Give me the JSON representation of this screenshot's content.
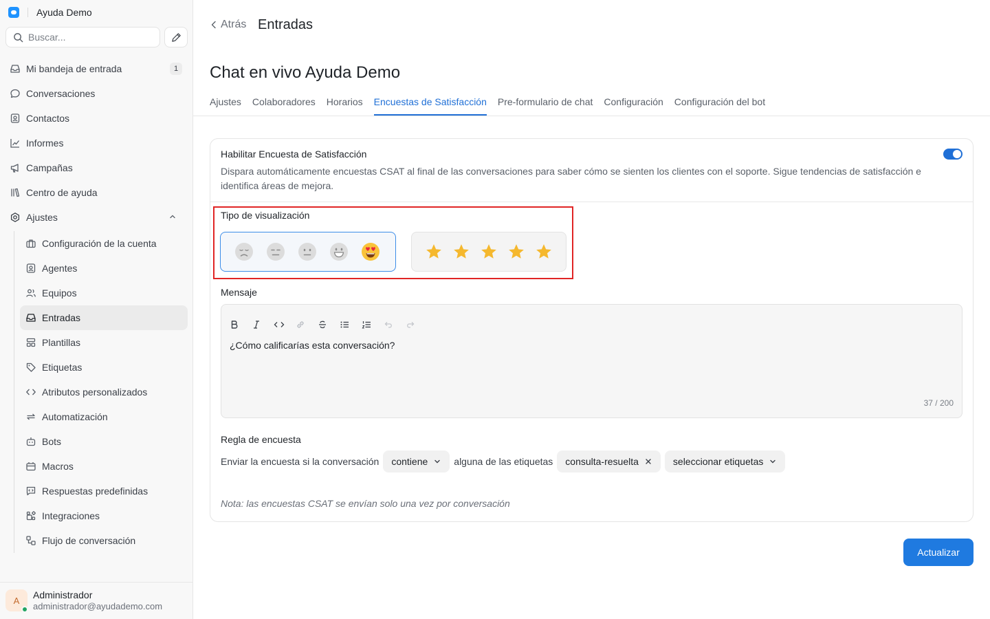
{
  "brand": {
    "name": "Ayuda Demo",
    "accent": "#1f93ff"
  },
  "search": {
    "placeholder": "Buscar..."
  },
  "sidebar": {
    "items": [
      {
        "label": "Mi bandeja de entrada",
        "icon": "inbox-icon",
        "badge": "1"
      },
      {
        "label": "Conversaciones",
        "icon": "chat-bubble-icon"
      },
      {
        "label": "Contactos",
        "icon": "contact-card-icon"
      },
      {
        "label": "Informes",
        "icon": "chart-line-icon"
      },
      {
        "label": "Campañas",
        "icon": "megaphone-icon"
      },
      {
        "label": "Centro de ayuda",
        "icon": "library-icon"
      },
      {
        "label": "Ajustes",
        "icon": "settings-gear-icon",
        "expanded": true
      }
    ],
    "settings_items": [
      {
        "label": "Configuración de la cuenta",
        "icon": "briefcase-icon"
      },
      {
        "label": "Agentes",
        "icon": "agent-card-icon"
      },
      {
        "label": "Equipos",
        "icon": "users-icon"
      },
      {
        "label": "Entradas",
        "icon": "inbox-icon",
        "active": true
      },
      {
        "label": "Plantillas",
        "icon": "template-icon"
      },
      {
        "label": "Etiquetas",
        "icon": "tag-icon"
      },
      {
        "label": "Atributos personalizados",
        "icon": "code-icon"
      },
      {
        "label": "Automatización",
        "icon": "arrows-repeat-icon"
      },
      {
        "label": "Bots",
        "icon": "bot-icon"
      },
      {
        "label": "Macros",
        "icon": "macro-box-icon"
      },
      {
        "label": "Respuestas predefinidas",
        "icon": "canned-reply-icon"
      },
      {
        "label": "Integraciones",
        "icon": "puzzle-icon"
      },
      {
        "label": "Flujo de conversación",
        "icon": "flow-icon"
      }
    ]
  },
  "user": {
    "initial": "A",
    "name": "Administrador",
    "email": "administrador@ayudademo.com",
    "status": "online"
  },
  "header": {
    "back_label": "Atrás",
    "title": "Entradas"
  },
  "inbox": {
    "name": "Chat en vivo Ayuda Demo"
  },
  "tabs": [
    {
      "label": "Ajustes"
    },
    {
      "label": "Colaboradores"
    },
    {
      "label": "Horarios"
    },
    {
      "label": "Encuestas de Satisfacción",
      "active": true
    },
    {
      "label": "Pre-formulario de chat"
    },
    {
      "label": "Configuración"
    },
    {
      "label": "Configuración del bot"
    }
  ],
  "csat": {
    "enable_title": "Habilitar Encuesta de Satisfacción",
    "enable_description": "Dispara automáticamente encuestas CSAT al final de las conversaciones para saber cómo se sienten los clientes con el soporte. Sigue tendencias de satisfacción e identifica áreas de mejora.",
    "enabled": true,
    "display_type_label": "Tipo de visualización",
    "display_options": [
      {
        "type": "emoji",
        "selected": true,
        "icons": [
          "disappointed-face-icon",
          "expressionless-face-icon",
          "neutral-face-icon",
          "grinning-face-icon",
          "heart-eyes-face-icon"
        ]
      },
      {
        "type": "stars",
        "selected": false,
        "icons": [
          "star-icon",
          "star-icon",
          "star-icon",
          "star-icon",
          "star-icon"
        ]
      }
    ],
    "message_label": "Mensaje",
    "message_text": "¿Cómo calificarías esta conversación?",
    "char_count": "37 / 200",
    "toolbar": [
      "bold-icon",
      "italic-icon",
      "code-icon",
      "link-icon",
      "strikethrough-icon",
      "bullet-list-icon",
      "numbered-list-icon",
      "undo-icon",
      "redo-icon"
    ],
    "rule_label": "Regla de encuesta",
    "rule_prefix": "Enviar la encuesta si la conversación",
    "rule_operator": "contiene",
    "rule_middle": "alguna de las etiquetas",
    "rule_selected_label": "consulta-resuelta",
    "rule_select_placeholder": "seleccionar etiquetas",
    "note": "Nota: las encuestas CSAT se envían solo una vez por conversación"
  },
  "actions": {
    "update_label": "Actualizar"
  },
  "colors": {
    "primary": "#1f7ae0",
    "tab_active": "#1f6fd6",
    "highlight_border": "#e02424",
    "star": "#f5b82e"
  }
}
